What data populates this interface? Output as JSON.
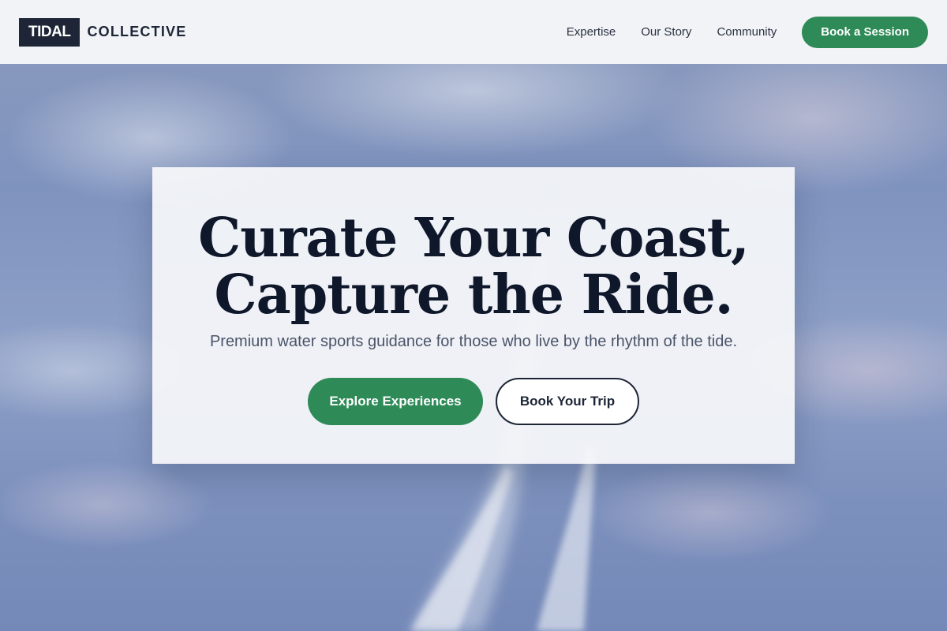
{
  "brand": {
    "logo_box": "TIDAL",
    "logo_text": "COLLECTIVE"
  },
  "nav": {
    "links": [
      "Expertise",
      "Our Story",
      "Community"
    ],
    "cta_label": "Book a Session"
  },
  "hero": {
    "title_line1": "Curate Your Coast,",
    "title_line2": "Capture the Ride.",
    "subtitle": "Premium water sports guidance for those who live by the rhythm of the tide.",
    "primary_button": "Explore Experiences",
    "secondary_button": "Book Your Trip"
  },
  "colors": {
    "brand_dark": "#1d2537",
    "accent_green": "#2e8a57",
    "header_bg": "#f1f3f6"
  }
}
